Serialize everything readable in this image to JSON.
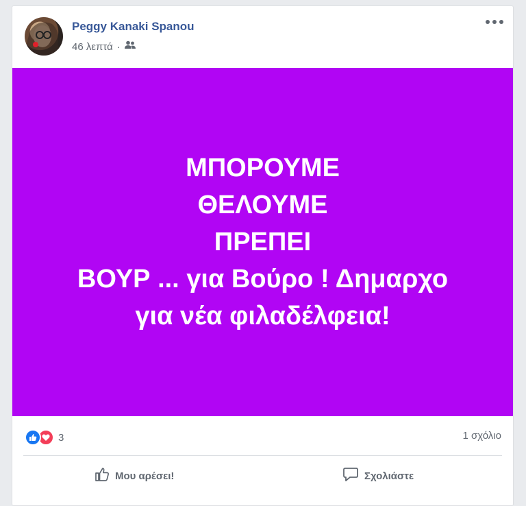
{
  "post": {
    "author": "Peggy Kanaki Spanou",
    "time": "46 λεπτά",
    "separator": "·",
    "audience_icon": "friends-icon"
  },
  "banner": {
    "background": "#b105f4",
    "lines": [
      "ΜΠΟΡΟΥΜΕ",
      "ΘΕΛΟΥΜΕ",
      "ΠΡΕΠΕΙ",
      "ΒΟΥΡ ... για Βούρο ! Δημαρχο",
      "για νέα φιλαδέλφεια!"
    ]
  },
  "stats": {
    "reaction_icons": [
      "like-reaction-icon",
      "love-reaction-icon"
    ],
    "reaction_count": "3",
    "comments": "1 σχόλιο"
  },
  "actions": {
    "like_label": "Μου αρέσει!",
    "comment_label": "Σχολιάστε"
  }
}
